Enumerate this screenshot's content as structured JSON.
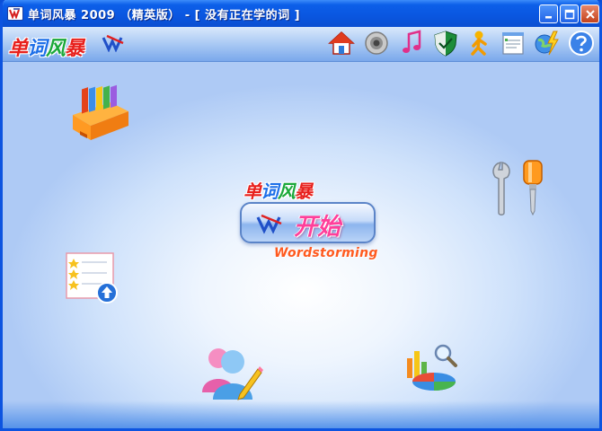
{
  "window": {
    "title": "单词风暴 2009 （精英版） - [ 没有正在学的词 ]",
    "controls": [
      "minimize",
      "maximize",
      "close"
    ]
  },
  "toolbar": {
    "logo_text": "单词风暴",
    "icons": [
      "home-icon",
      "speaker-icon",
      "music-note-icon",
      "shield-icon",
      "person-icon",
      "notepad-icon",
      "globe-lightning-icon",
      "help-icon"
    ]
  },
  "main": {
    "center_logo_text": "单词风暴",
    "start_label": "开始",
    "brand_en": "Wordstorming",
    "features": [
      "book-shelf-icon",
      "tools-icon",
      "checklist-upload-icon",
      "users-icon",
      "chart-icon"
    ]
  },
  "colors": {
    "titlebar": "#0a56e0",
    "logo_red": "#e8211d",
    "logo_blue": "#1d6fe8",
    "logo_green": "#1aa83a",
    "start_text": "#ff3f9a",
    "brand_en": "#ff5a1f"
  }
}
